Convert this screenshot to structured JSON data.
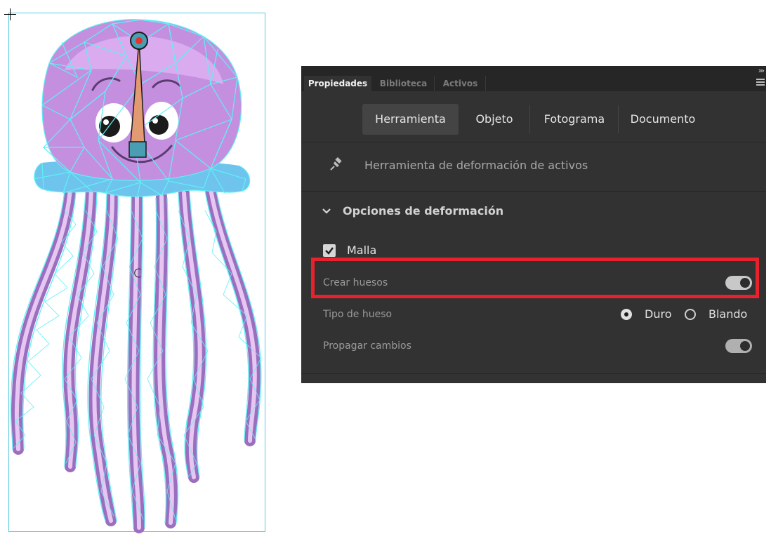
{
  "panel": {
    "tabs": [
      {
        "label": "Propiedades",
        "active": true
      },
      {
        "label": "Biblioteca",
        "active": false
      },
      {
        "label": "Activos",
        "active": false
      }
    ],
    "collapse_icon": "double-chevron-right-icon",
    "menu_icon": "hamburger-menu-icon",
    "segments": [
      "Herramienta",
      "Objeto",
      "Fotograma",
      "Documento"
    ],
    "active_segment": "Herramienta",
    "tool_icon": "pin-icon",
    "tool_name": "Herramienta de deformación de activos",
    "section": {
      "icon": "chevron-down-icon",
      "title": "Opciones de deformación"
    },
    "mesh": {
      "label": "Malla",
      "checked": true
    },
    "create_bones": {
      "label": "Crear huesos",
      "on": true
    },
    "bone_type": {
      "label": "Tipo de hueso",
      "options": [
        "Duro",
        "Blando"
      ],
      "selected": "Duro"
    },
    "propagate": {
      "label": "Propagar cambios",
      "on": true
    }
  },
  "colors": {
    "panel_bg": "#323232",
    "tabbar_bg": "#262626",
    "highlight": "#e8222c",
    "mesh": "#5ef0f5",
    "jelly_body": "#c58fdf",
    "jelly_skirt": "#6fc4ee",
    "bone": "#e19a72",
    "bone_joint": "#4a9eb3"
  },
  "stage": {
    "crosshair_icon": "crosshair-cursor-icon",
    "pivot_icon": "rotation-pivot-icon"
  }
}
